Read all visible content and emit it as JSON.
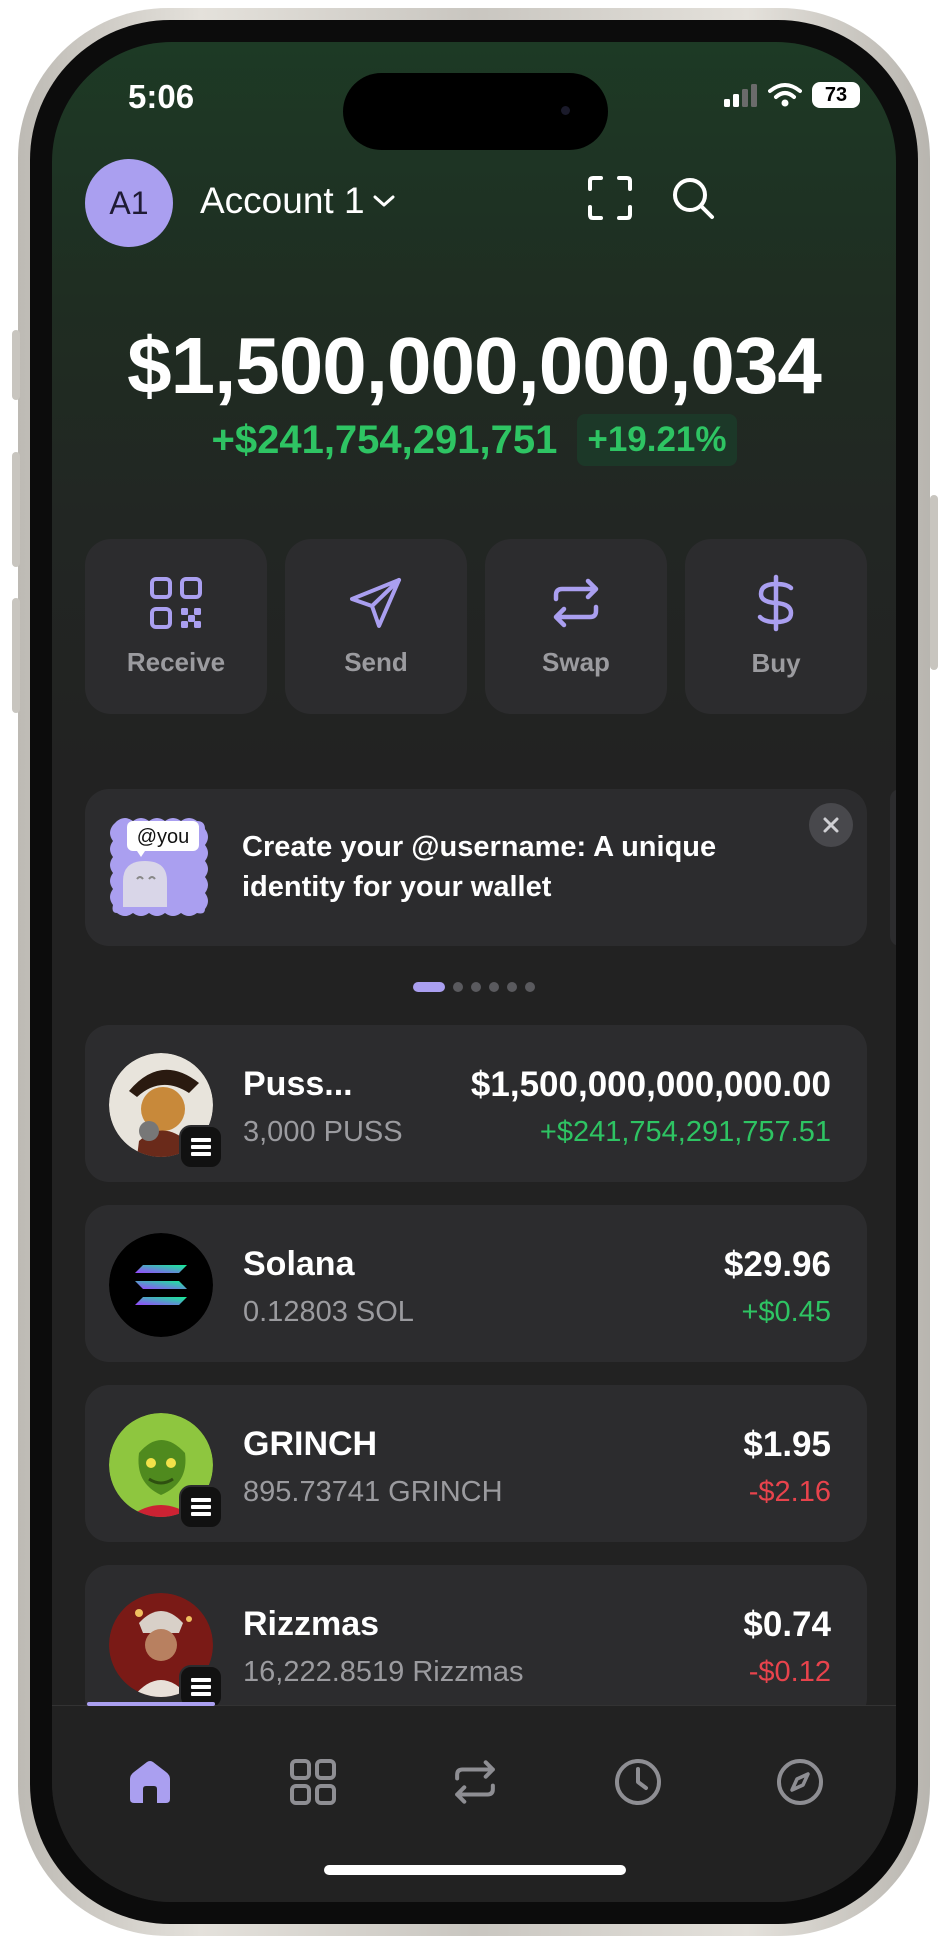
{
  "status_bar": {
    "time": "5:06",
    "battery": "73"
  },
  "header": {
    "avatar_initials": "A1",
    "account_name": "Account 1"
  },
  "portfolio": {
    "balance": "$1,500,000,000,034",
    "change_amount": "+$241,754,291,751",
    "change_percent": "+19.21%"
  },
  "actions": [
    {
      "label": "Receive",
      "icon": "qr-code-icon"
    },
    {
      "label": "Send",
      "icon": "send-icon"
    },
    {
      "label": "Swap",
      "icon": "swap-icon"
    },
    {
      "label": "Buy",
      "icon": "dollar-icon"
    }
  ],
  "banner": {
    "badge_text": "@you",
    "line1": "Create your @username: A unique",
    "line2": "identity for your wallet"
  },
  "carousel": {
    "pages": 6,
    "active": 1
  },
  "tokens": [
    {
      "name": "Puss...",
      "amount": "3,000 PUSS",
      "value": "$1,500,000,000,000.00",
      "change": "+$241,754,291,757.51",
      "direction": "up"
    },
    {
      "name": "Solana",
      "amount": "0.12803 SOL",
      "value": "$29.96",
      "change": "+$0.45",
      "direction": "up"
    },
    {
      "name": "GRINCH",
      "amount": "895.73741 GRINCH",
      "value": "$1.95",
      "change": "-$2.16",
      "direction": "down"
    },
    {
      "name": "Rizzmas",
      "amount": "16,222.8519 Rizzmas",
      "value": "$0.74",
      "change": "-$0.12",
      "direction": "down"
    }
  ],
  "tab_bar": [
    {
      "icon": "home-icon",
      "active": true
    },
    {
      "icon": "grid-icon",
      "active": false
    },
    {
      "icon": "swap-icon",
      "active": false
    },
    {
      "icon": "clock-icon",
      "active": false
    },
    {
      "icon": "compass-icon",
      "active": false
    }
  ],
  "colors": {
    "accent": "#aa9ff0",
    "positive": "#2ec463",
    "negative": "#e8434c",
    "card": "#2c2c2e"
  }
}
